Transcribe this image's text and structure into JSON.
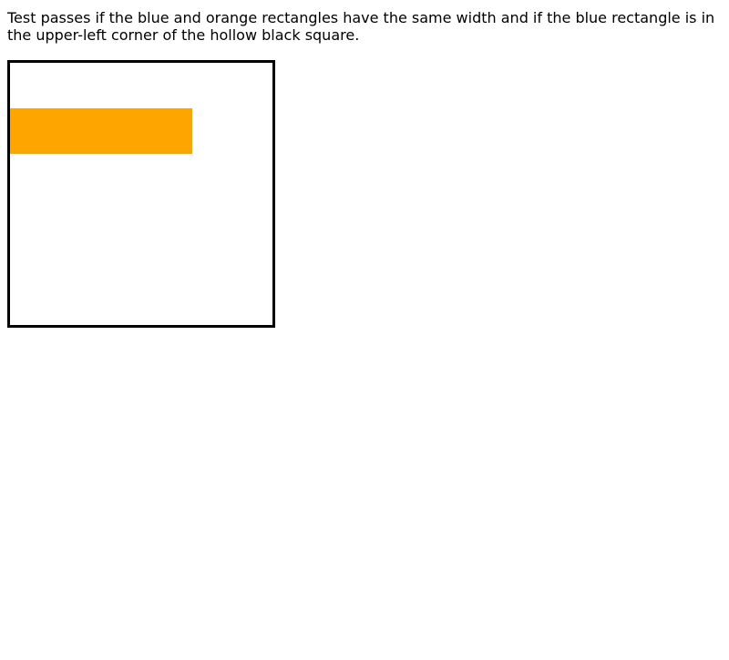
{
  "instructions": "Test passes if the blue and orange rectangles have the same width and if the blue rectangle is in the upper-left corner of the hollow black square.",
  "colors": {
    "square_border": "#000000",
    "orange_rectangle": "#ffa500",
    "background": "#ffffff"
  }
}
